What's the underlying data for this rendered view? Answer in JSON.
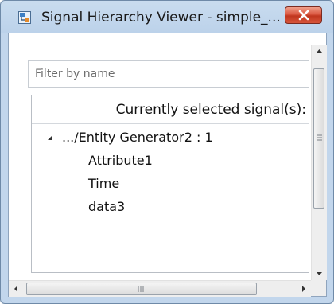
{
  "window": {
    "title": "Signal Hierarchy Viewer - simple_..."
  },
  "filter": {
    "placeholder": "Filter by name",
    "value": ""
  },
  "tree": {
    "header": "Currently selected signal(s):",
    "root": {
      "label": ".../Entity Generator2 : 1",
      "expanded": true,
      "children": [
        "Attribute1",
        "Time",
        "data3"
      ]
    }
  },
  "icons": {
    "app": "signal-hierarchy-app-icon",
    "close": "close-icon",
    "expand": "expanded-triangle-icon"
  },
  "colors": {
    "title_bar": "#c9dcef",
    "close_button": "#d9563f"
  }
}
